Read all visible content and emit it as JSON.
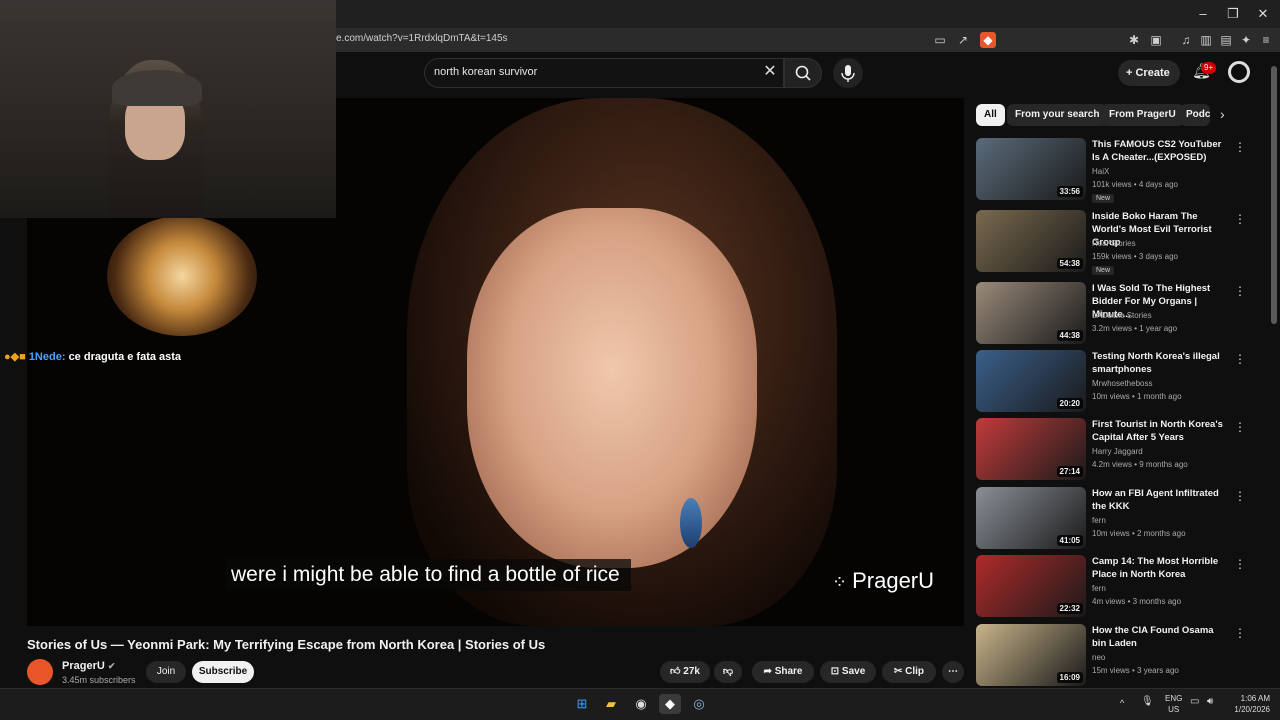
{
  "browser": {
    "url": "e.com/watch?v=1RrdxlqDmTA&t=145s",
    "win_controls": [
      "–",
      "❐",
      "✕"
    ]
  },
  "topbar": {
    "search_value": "north korean survivor",
    "create_label": "Create",
    "notif_badge": "9+"
  },
  "video": {
    "caption": "were i might be able to find a bottle of rice",
    "watermark": "PragerU",
    "chat_user": "1Nede:",
    "chat_text": "ce draguta e fata asta",
    "title": "Stories of Us — Yeonmi Park: My Terrifying Escape from North Korea | Stories of Us",
    "channel": "PragerU",
    "subscribers": "3.45m subscribers",
    "join_label": "Join",
    "subscribe_label": "Subscribe",
    "likes": "27k",
    "share_label": "Share",
    "save_label": "Save",
    "clip_label": "Clip"
  },
  "sidebar": {
    "chips": [
      "All",
      "From your search",
      "From PragerU",
      "Podc"
    ],
    "items": [
      {
        "title": "This FAMOUS CS2 YouTuber Is A Cheater...(EXPOSED)",
        "channel": "HaiX",
        "meta": "101k views • 4 days ago",
        "duration": "33:56",
        "new": "New",
        "thumb": "#5a6b7a"
      },
      {
        "title": "Inside Boko Haram The World's Most Evil Terrorist Group",
        "channel": "Real Stories",
        "meta": "159k views • 3 days ago",
        "duration": "54:38",
        "new": "New",
        "thumb": "#7a6a4e"
      },
      {
        "title": "I Was Sold To The Highest Bidder For My Organs | Minute...",
        "channel": "LADbible Stories",
        "meta": "3.2m views • 1 year ago",
        "duration": "44:38",
        "new": "",
        "thumb": "#9a8a7a"
      },
      {
        "title": "Testing North Korea's illegal smartphones",
        "channel": "Mrwhosetheboss",
        "meta": "10m views • 1 month ago",
        "duration": "20:20",
        "new": "",
        "thumb": "#3a5f8a"
      },
      {
        "title": "First Tourist in North Korea's Capital After 5 Years",
        "channel": "Harry Jaggard",
        "meta": "4.2m views • 9 months ago",
        "duration": "27:14",
        "new": "",
        "thumb": "#c23b3b"
      },
      {
        "title": "How an FBI Agent Infiltrated the KKK",
        "channel": "fern",
        "meta": "10m views • 2 months ago",
        "duration": "41:05",
        "new": "",
        "thumb": "#8a8f96"
      },
      {
        "title": "Camp 14: The Most Horrible Place in North Korea",
        "channel": "fern",
        "meta": "4m views • 3 months ago",
        "duration": "22:32",
        "new": "",
        "thumb": "#b02a2a"
      },
      {
        "title": "How the CIA Found Osama bin Laden",
        "channel": "neo",
        "meta": "15m views • 3 years ago",
        "duration": "16:09",
        "new": "",
        "thumb": "#c9b48a"
      }
    ]
  },
  "taskbar": {
    "lang_top": "ENG",
    "lang_bottom": "US",
    "time": "1:06 AM",
    "date": "1/20/2026"
  },
  "colors": {
    "accent": "#cc0000",
    "bg": "#0f0f0f",
    "chip": "#272727"
  }
}
